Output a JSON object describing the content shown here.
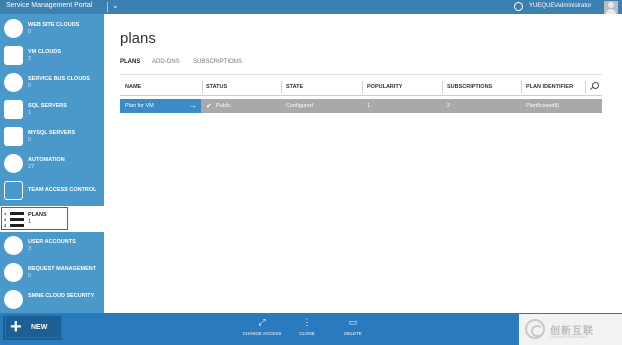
{
  "topbar": {
    "title": "Service Management Portal",
    "user": "YUEQUE\\Administrator"
  },
  "sidebar": {
    "items": [
      {
        "label": "WEB SITE CLOUDS",
        "count": "0",
        "icon": "globe-icon"
      },
      {
        "label": "VM CLOUDS",
        "count": "2",
        "icon": "monitor-icon"
      },
      {
        "label": "SERVICE BUS CLOUDS",
        "count": "0",
        "icon": "service-bus-icon"
      },
      {
        "label": "SQL SERVERS",
        "count": "1",
        "icon": "sql-server-icon"
      },
      {
        "label": "MYSQL SERVERS",
        "count": "0",
        "icon": "mysql-icon"
      },
      {
        "label": "AUTOMATION",
        "count": "27",
        "icon": "gears-icon"
      },
      {
        "label": "TEAM ACCESS CONTROL",
        "count": "",
        "icon": "cloud-icon"
      },
      {
        "label": "PLANS",
        "count": "1",
        "icon": "list-icon"
      },
      {
        "label": "USER ACCOUNTS",
        "count": "3",
        "icon": "users-icon"
      },
      {
        "label": "REQUEST MANAGEMENT",
        "count": "0",
        "icon": "refresh-icon"
      },
      {
        "label": "SMNE CLOUD SECURITY",
        "count": "",
        "icon": "cloud-security-icon"
      }
    ]
  },
  "main": {
    "title": "plans",
    "tabs": [
      "PLANS",
      "ADD-ONS",
      "SUBSCRIPTIONS"
    ],
    "columns": [
      "NAME",
      "STATUS",
      "STATE",
      "POPULARITY",
      "SUBSCRIPTIONS",
      "PLAN IDENTIFIER"
    ],
    "rows": [
      {
        "name": "Plan for VM",
        "status": "Public",
        "state": "Configured",
        "popularity": "1",
        "subscriptions": "2",
        "identifier": "Planflcxaed8j"
      }
    ]
  },
  "bottombar": {
    "new_label": "NEW",
    "actions": [
      {
        "label": "CHANGE ACCESS",
        "icon": "change-access-icon"
      },
      {
        "label": "CLONE",
        "icon": "clone-icon"
      },
      {
        "label": "DELETE",
        "icon": "trash-icon"
      }
    ]
  },
  "watermark": {
    "text": "创新互联",
    "sub": "CHUANG XIN HU LIAN"
  },
  "colors": {
    "topbar": "#3c7fb1",
    "sidebar": "#4b98ca",
    "bottombar": "#2a7bbd",
    "selected_row": "#3a8bc7",
    "highlight": "#d03030"
  }
}
